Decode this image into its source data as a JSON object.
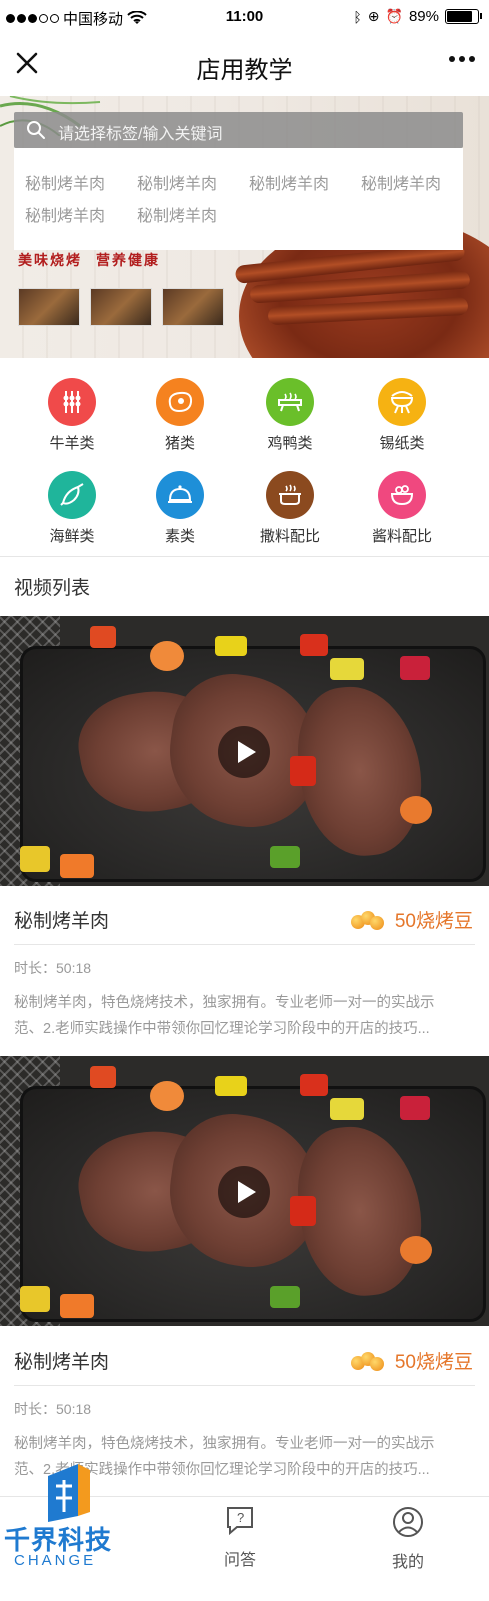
{
  "status_bar": {
    "carrier": "中国移动",
    "time": "11:00",
    "battery_percent": "89%",
    "battery_level": 0.89,
    "signal_bars": 3
  },
  "nav": {
    "title": "店用教学"
  },
  "banner": {
    "search_placeholder": "请选择标签/输入关键词",
    "tag_options": [
      "秘制烤羊肉",
      "秘制烤羊肉",
      "秘制烤羊肉",
      "秘制烤羊肉",
      "秘制烤羊肉",
      "秘制烤羊肉"
    ],
    "slogans": [
      "美味烧烤",
      "营养健康"
    ]
  },
  "categories": [
    {
      "label": "牛羊类",
      "color": "#f04a4a",
      "icon": "skewers-icon"
    },
    {
      "label": "猪类",
      "color": "#f5821f",
      "icon": "meat-icon"
    },
    {
      "label": "鸡鸭类",
      "color": "#6abf2a",
      "icon": "grill-tray-icon"
    },
    {
      "label": "锡纸类",
      "color": "#f6b212",
      "icon": "bbq-grill-icon"
    },
    {
      "label": "海鲜类",
      "color": "#1fb59b",
      "icon": "seafood-icon"
    },
    {
      "label": "素类",
      "color": "#1e8fd8",
      "icon": "cloche-icon"
    },
    {
      "label": "撒料配比",
      "color": "#8b4a1f",
      "icon": "pot-icon"
    },
    {
      "label": "酱料配比",
      "color": "#f0487f",
      "icon": "bowl-icon"
    }
  ],
  "video_section": {
    "title": "视频列表",
    "videos": [
      {
        "title": "秘制烤羊肉",
        "price": "50烧烤豆",
        "duration": "时长：50:18",
        "description_line1": "秘制烤羊肉，特色烧烤技术，独家拥有。专业老师一对一的实战示",
        "description_line2": "范、2.老师实践操作中带领你回忆理论学习阶段中的开店的技巧..."
      },
      {
        "title": "秘制烤羊肉",
        "price": "50烧烤豆",
        "duration": "时长：50:18",
        "description_line1": "秘制烤羊肉，特色烧烤技术，独家拥有。专业老师一对一的实战示",
        "description_line2": "范、2.老师实践操作中带领你回忆理论学习阶段中的开店的技巧..."
      }
    ]
  },
  "tabbar": {
    "tabs": [
      {
        "label": "问答",
        "icon": "qa-icon"
      },
      {
        "label": "我的",
        "icon": "profile-icon"
      }
    ]
  },
  "watermark": {
    "name": "千界科技",
    "sub": "CHANGE"
  },
  "colors": {
    "accent_orange": "#e5762a"
  }
}
